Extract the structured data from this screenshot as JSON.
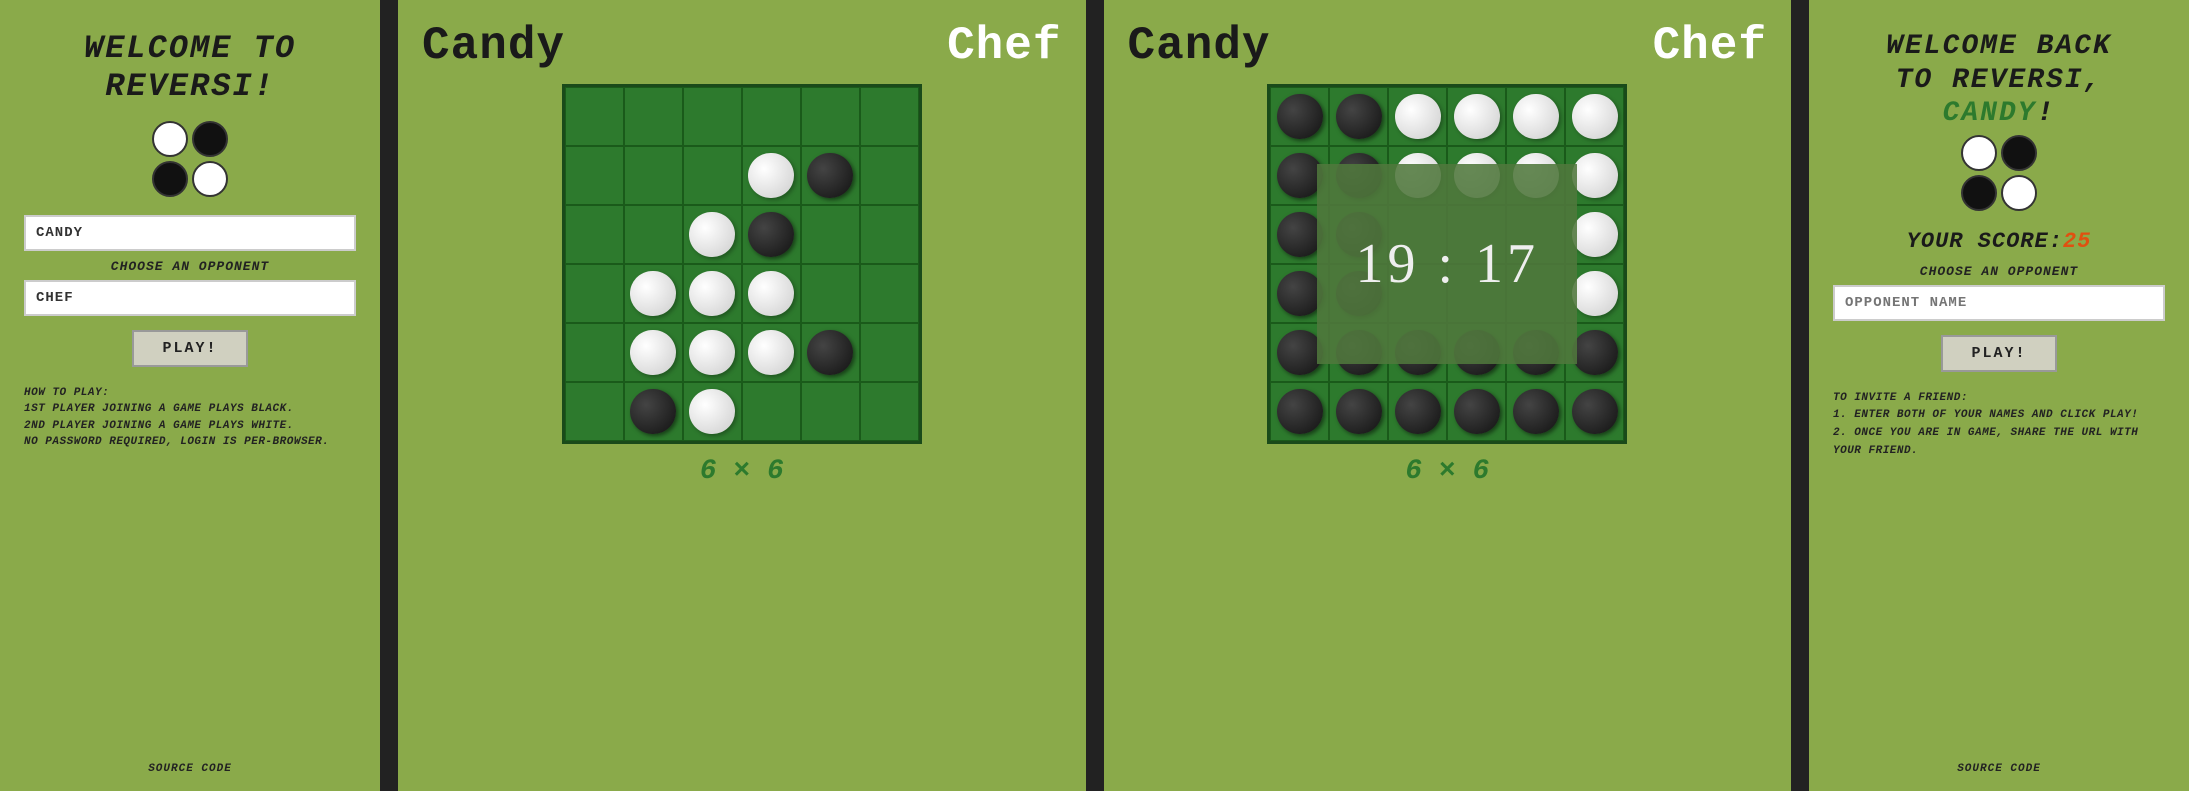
{
  "left_panel": {
    "title_line1": "WELCOME TO",
    "title_line2": "REVERSI!",
    "player_input_value": "CANDY",
    "choose_opponent_label": "CHOOSE AN OPPONENT",
    "opponent_input_value": "CHEF",
    "play_button": "PLAY!",
    "how_to_play_title": "HOW TO PLAY:",
    "how_to_play_lines": [
      "1ST PLAYER JOINING A GAME PLAYS BLACK.",
      "2ND PLAYER JOINING A GAME PLAYS WHITE.",
      "NO PASSWORD REQUIRED, LOGIN IS PER-BROWSER."
    ],
    "source_code": "SOURCE CODE"
  },
  "game1": {
    "player_black": "Candy",
    "player_white": "Chef",
    "size_label": "6 × 6",
    "board": [
      [
        "",
        "",
        "",
        "",
        "",
        ""
      ],
      [
        "",
        "",
        "",
        "w",
        "b",
        ""
      ],
      [
        "",
        "",
        "w",
        "b",
        "",
        ""
      ],
      [
        "",
        "w",
        "w",
        "w",
        "",
        ""
      ],
      [
        "",
        "w",
        "w",
        "w",
        "b",
        ""
      ],
      [
        "",
        "b",
        "w",
        "",
        "",
        ""
      ]
    ]
  },
  "game2": {
    "player_black": "Candy",
    "player_white": "Chef",
    "size_label": "6 × 6",
    "score_display": "19 : 17",
    "board": [
      [
        "b",
        "b",
        "w",
        "w",
        "w",
        "w"
      ],
      [
        "b",
        "b",
        "w",
        "w",
        "w",
        "w"
      ],
      [
        "b",
        "b",
        "",
        "",
        "",
        "w"
      ],
      [
        "b",
        "b",
        "",
        "",
        "",
        "w"
      ],
      [
        "b",
        "b",
        "b",
        "b",
        "b",
        "b"
      ],
      [
        "b",
        "b",
        "b",
        "b",
        "b",
        "b"
      ]
    ]
  },
  "right_panel": {
    "title_line1": "WELCOME BACK",
    "title_line2": "TO REVERSI,",
    "player_name": "CANDY",
    "exclamation": "!",
    "score_label": "YOUR SCORE:",
    "score_value": "25",
    "choose_opponent_label": "CHOOSE AN OPPONENT",
    "opponent_placeholder": "OPPONENT NAME",
    "play_button": "PLAY!",
    "invite_title": "TO INVITE A FRIEND:",
    "invite_lines": [
      "1. ENTER BOTH OF YOUR NAMES AND CLICK PLAY!",
      "2. ONCE YOU ARE IN GAME, SHARE THE URL WITH YOUR FRIEND."
    ],
    "source_code": "SOURCE CODE"
  }
}
